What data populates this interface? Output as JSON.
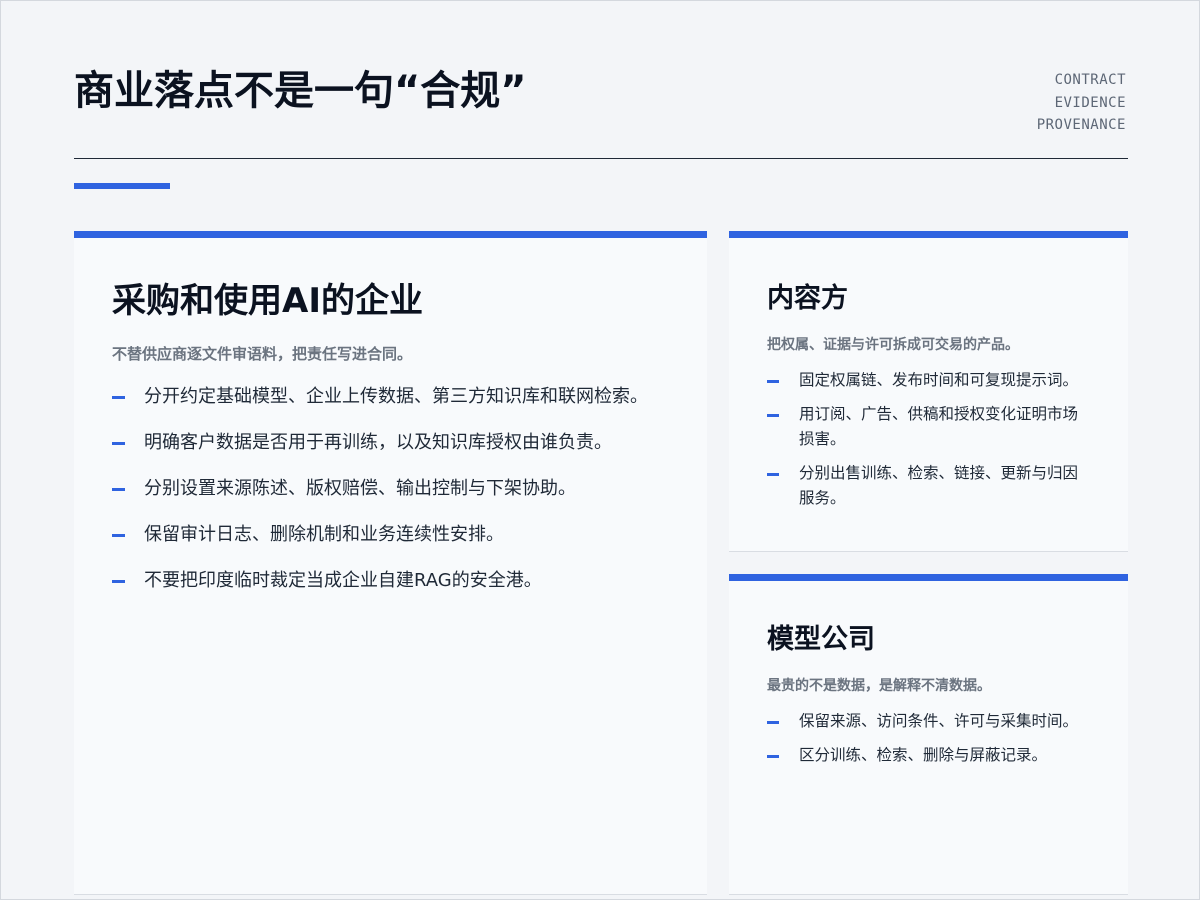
{
  "header": {
    "title": "商业落点不是一句“合规”",
    "tags": [
      "CONTRACT",
      "EVIDENCE",
      "PROVENANCE"
    ]
  },
  "cards": [
    {
      "heading": "采购和使用AI的企业",
      "subtitle": "不替供应商逐文件审语料，把责任写进合同。",
      "items": [
        "分开约定基础模型、企业上传数据、第三方知识库和联网检索。",
        "明确客户数据是否用于再训练，以及知识库授权由谁负责。",
        "分别设置来源陈述、版权赔偿、输出控制与下架协助。",
        "保留审计日志、删除机制和业务连续性安排。",
        "不要把印度临时裁定当成企业自建RAG的安全港。"
      ]
    },
    {
      "heading": "内容方",
      "subtitle": "把权属、证据与许可拆成可交易的产品。",
      "items": [
        "固定权属链、发布时间和可复现提示词。",
        "用订阅、广告、供稿和授权变化证明市场损害。",
        "分别出售训练、检索、链接、更新与归因服务。"
      ]
    },
    {
      "heading": "模型公司",
      "subtitle": "最贵的不是数据，是解释不清数据。",
      "items": [
        "保留来源、访问条件、许可与采集时间。",
        "区分训练、检索、删除与屏蔽记录。"
      ]
    }
  ],
  "colors": {
    "accent": "#2f63e0",
    "background": "#f3f5f8",
    "card": "#f8fafc",
    "subtitle": "#6b7480"
  }
}
